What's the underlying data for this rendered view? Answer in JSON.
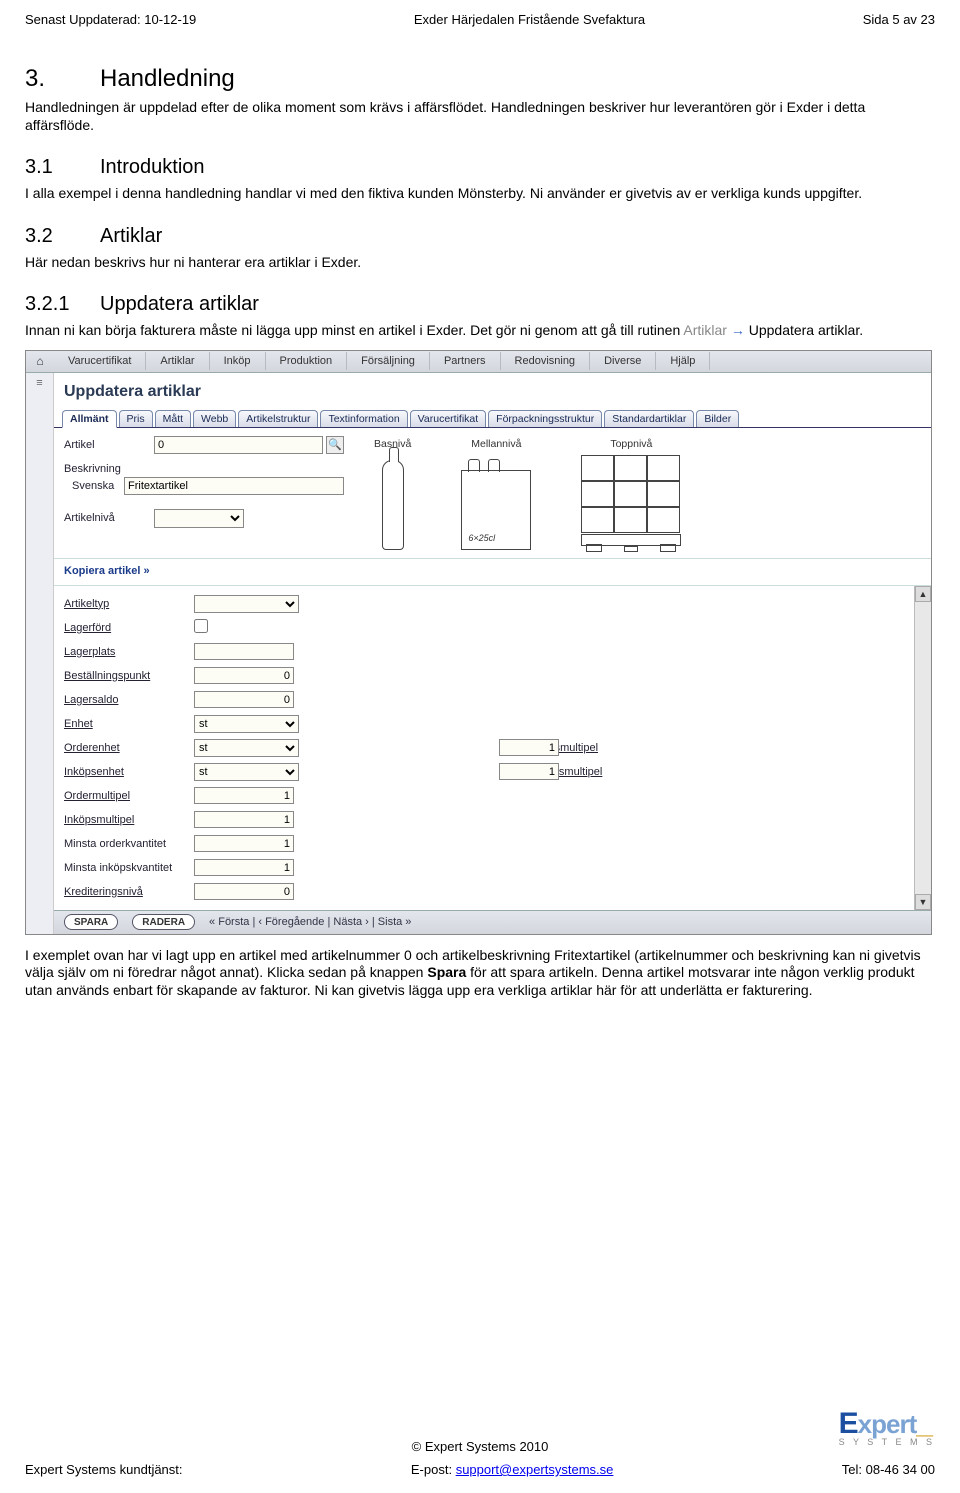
{
  "header": {
    "left": "Senast Uppdaterad: 10-12-19",
    "center": "Exder Härjedalen Fristående Svefaktura",
    "right": "Sida 5 av 23"
  },
  "h1": {
    "num": "3.",
    "title": "Handledning"
  },
  "p1": "Handledningen är uppdelad efter de olika moment som krävs i affärsflödet. Handledningen beskriver hur leverantören gör i Exder i detta affärsflöde.",
  "h2a": {
    "num": "3.1",
    "title": "Introduktion"
  },
  "p2": "I alla exempel i denna handledning handlar vi med den fiktiva kunden Mönsterby. Ni använder er givetvis av er verkliga kunds uppgifter.",
  "h2b": {
    "num": "3.2",
    "title": "Artiklar"
  },
  "p3": "Här nedan beskrivs hur ni hanterar era artiklar i Exder.",
  "h2c": {
    "num": "3.2.1",
    "title": "Uppdatera artiklar"
  },
  "p4a": "Innan ni kan börja fakturera måste ni lägga upp minst en artikel i Exder. Det gör ni genom att gå till rutinen ",
  "p4_gray": "Artiklar",
  "p4_arrow": " → ",
  "p4b": "Uppdatera artiklar.",
  "screenshot": {
    "menus": [
      "Varucertifikat",
      "Artiklar",
      "Inköp",
      "Produktion",
      "Försäljning",
      "Partners",
      "Redovisning",
      "Diverse",
      "Hjälp"
    ],
    "panel_title": "Uppdatera artiklar",
    "tabs": [
      "Allmänt",
      "Pris",
      "Mått",
      "Webb",
      "Artikelstruktur",
      "Textinformation",
      "Varucertifikat",
      "Förpackningsstruktur",
      "Standardartiklar",
      "Bilder"
    ],
    "form": {
      "artikel_label": "Artikel",
      "artikel_value": "0",
      "beskrivning_label": "Beskrivning",
      "svenska_label": "Svenska",
      "svenska_value": "Fritextartikel",
      "artikelniva_label": "Artikelnivå"
    },
    "niva": {
      "bas": "Basnivå",
      "mellan": "Mellannivå",
      "topp": "Toppnivå",
      "sixpack_label": "6×25cl"
    },
    "kopiera_link": "Kopiera artikel »",
    "rows": [
      {
        "type": "select",
        "label": "Artikeltyp",
        "u": true,
        "value": ""
      },
      {
        "type": "check",
        "label": "Lagerförd",
        "u": true
      },
      {
        "type": "text",
        "label": "Lagerplats",
        "u": true,
        "value": ""
      },
      {
        "type": "num",
        "label": "Beställningspunkt",
        "u": true,
        "value": "0"
      },
      {
        "type": "num",
        "label": "Lagersaldo",
        "u": true,
        "value": "0"
      },
      {
        "type": "select",
        "label": "Enhet",
        "u": true,
        "value": "st"
      },
      {
        "type": "select",
        "label": "Orderenhet",
        "u": true,
        "value": "st",
        "label2": "Orderenhetsmultipel",
        "value2": "1"
      },
      {
        "type": "select",
        "label": "Inköpsenhet",
        "u": true,
        "value": "st",
        "label2": "Inköpsenhetsmultipel",
        "value2": "1"
      },
      {
        "type": "num",
        "label": "Ordermultipel",
        "u": true,
        "value": "1"
      },
      {
        "type": "num",
        "label": "Inköpsmultipel",
        "u": true,
        "value": "1"
      },
      {
        "type": "num",
        "label": "Minsta orderkvantitet",
        "u": false,
        "value": "1"
      },
      {
        "type": "num",
        "label": "Minsta inköpskvantitet",
        "u": false,
        "value": "1"
      },
      {
        "type": "num",
        "label": "Krediteringsnivå",
        "u": true,
        "value": "0"
      }
    ],
    "bottombar": {
      "spara": "SPARA",
      "radera": "RADERA",
      "nav": "« Första  |  ‹ Föregående  |  Nästa ›  |  Sista »"
    }
  },
  "p5": "I exemplet ovan har vi lagt upp en artikel med artikelnummer 0 och artikelbeskrivning Fritextartikel (artikelnummer och beskrivning kan ni givetvis välja själv om ni föredrar något annat). Klicka sedan på knappen ",
  "p5_bold": "Spara",
  "p5b": " för att spara artikeln. Denna artikel motsvarar inte någon verklig produkt utan används enbart för skapande av fakturor. Ni kan givetvis lägga upp era verkliga artiklar här för att underlätta er fakturering.",
  "footer": {
    "copyright": "© Expert Systems 2010",
    "left": "Expert Systems kundtjänst:",
    "center_label": "E-post: ",
    "center_link": "support@expertsystems.se",
    "right": "Tel: 08-46 34 00",
    "logo_sub": "S Y S T E M S"
  }
}
